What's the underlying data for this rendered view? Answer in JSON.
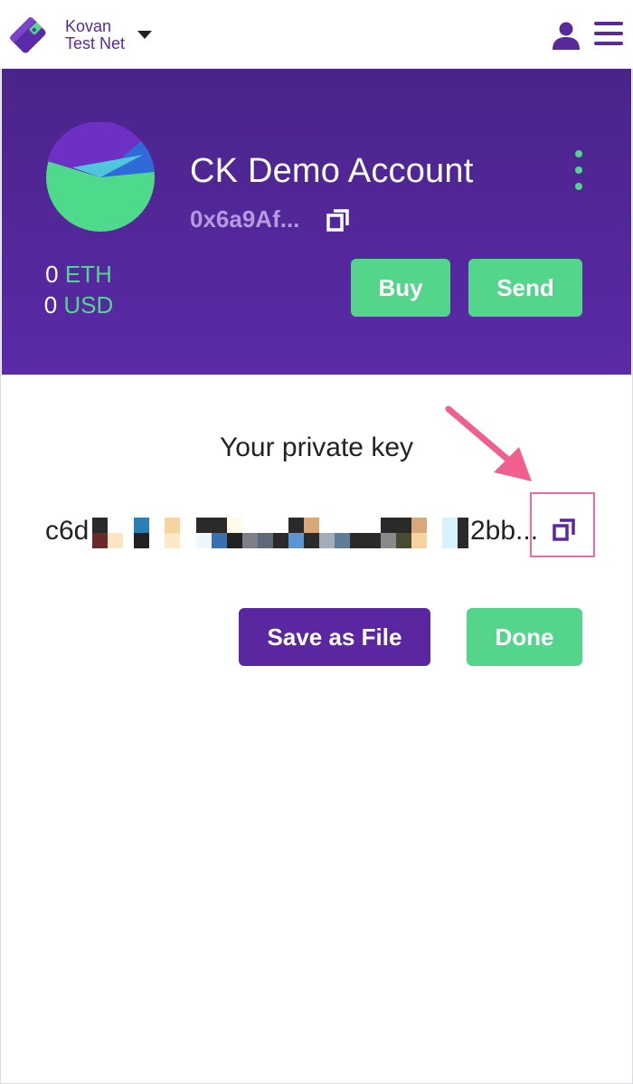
{
  "network": {
    "line1": "Kovan",
    "line2": "Test Net"
  },
  "account": {
    "name": "CK Demo Account",
    "address": "0x6a9Af...",
    "eth_amount": "0",
    "eth_unit": "ETH",
    "usd_amount": "0",
    "usd_unit": "USD"
  },
  "actions": {
    "buy": "Buy",
    "send": "Send"
  },
  "private_key": {
    "title": "Your private key",
    "visible_prefix": "c6d",
    "visible_suffix": "2bb..."
  },
  "footer_actions": {
    "save": "Save as File",
    "done": "Done"
  },
  "colors": {
    "brand_purple": "#5a27a0",
    "header_gradient_top": "#4a2489",
    "accent_green": "#53d68c",
    "address_lilac": "#b69adf",
    "highlight_pink": "#ee6a9c"
  },
  "icons": {
    "logo": "wallet-logo-icon",
    "user": "user-icon",
    "menu": "hamburger-menu-icon",
    "copy": "copy-icon",
    "more": "kebab-menu-icon"
  }
}
